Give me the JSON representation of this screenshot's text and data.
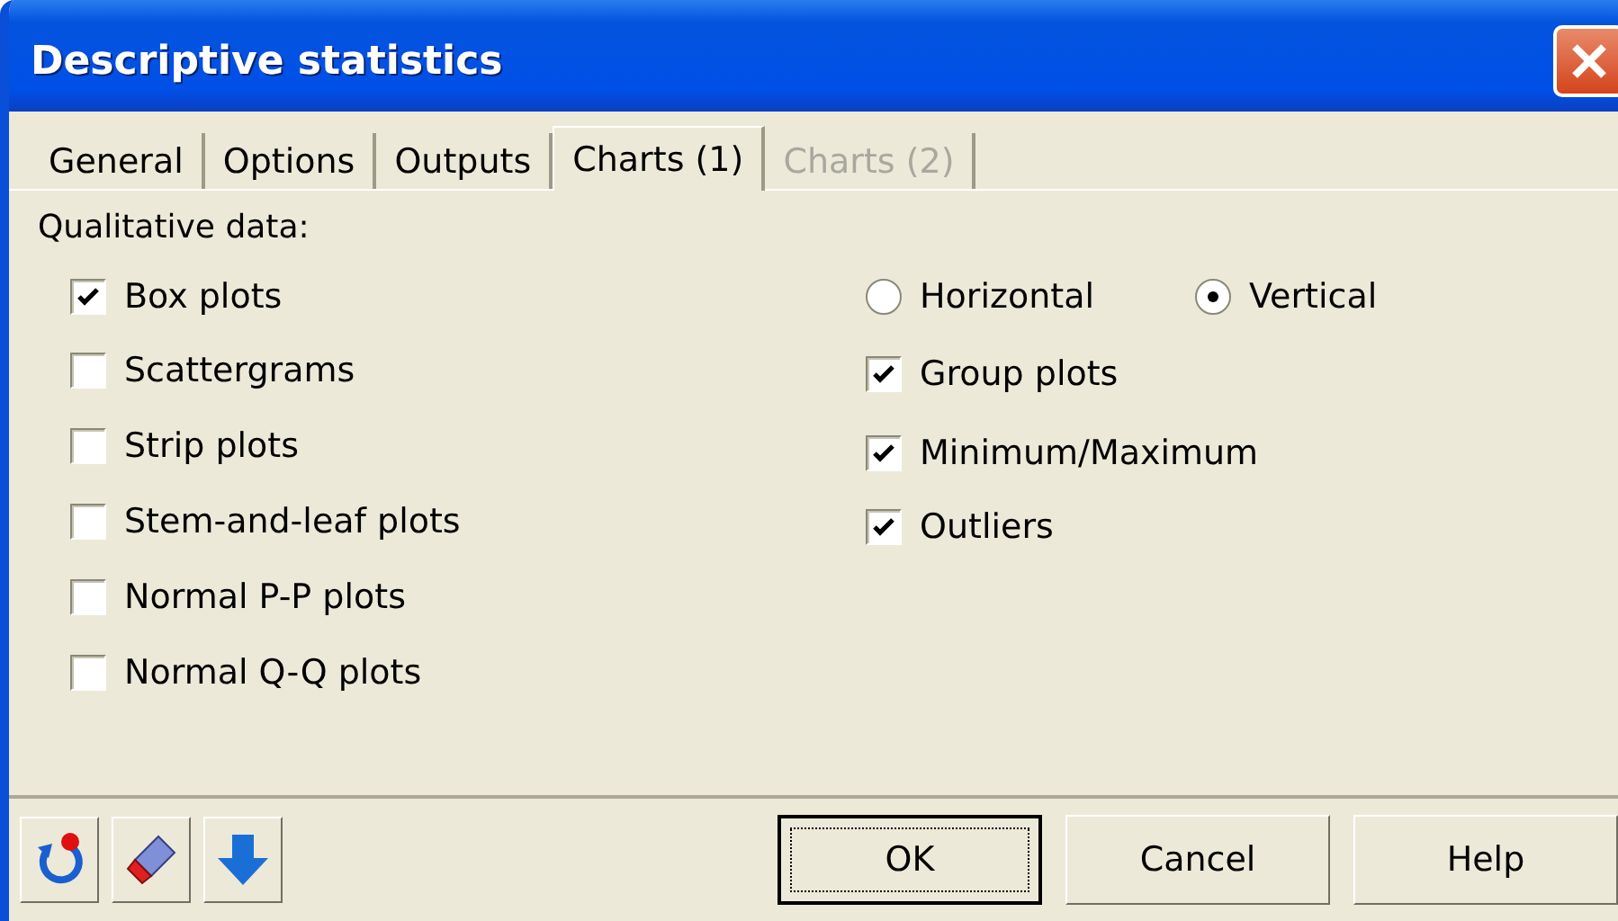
{
  "window": {
    "title": "Descriptive statistics"
  },
  "tabs": [
    {
      "label": "General",
      "selected": false,
      "disabled": false
    },
    {
      "label": "Options",
      "selected": false,
      "disabled": false
    },
    {
      "label": "Outputs",
      "selected": false,
      "disabled": false
    },
    {
      "label": "Charts (1)",
      "selected": true,
      "disabled": false
    },
    {
      "label": "Charts (2)",
      "selected": false,
      "disabled": true
    }
  ],
  "section_label": "Qualitative data:",
  "left_options": [
    {
      "label": "Box plots",
      "checked": true
    },
    {
      "label": "Scattergrams",
      "checked": false
    },
    {
      "label": "Strip plots",
      "checked": false
    },
    {
      "label": "Stem-and-leaf plots",
      "checked": false
    },
    {
      "label": "Normal P-P plots",
      "checked": false
    },
    {
      "label": "Normal Q-Q plots",
      "checked": false
    }
  ],
  "orientation": [
    {
      "label": "Horizontal",
      "selected": false
    },
    {
      "label": "Vertical",
      "selected": true
    }
  ],
  "right_options": [
    {
      "label": "Group plots",
      "checked": true
    },
    {
      "label": "Minimum/Maximum",
      "checked": true
    },
    {
      "label": "Outliers",
      "checked": true
    }
  ],
  "buttons": [
    {
      "label": "OK",
      "default": true
    },
    {
      "label": "Cancel",
      "default": false
    },
    {
      "label": "Help",
      "default": false
    }
  ]
}
